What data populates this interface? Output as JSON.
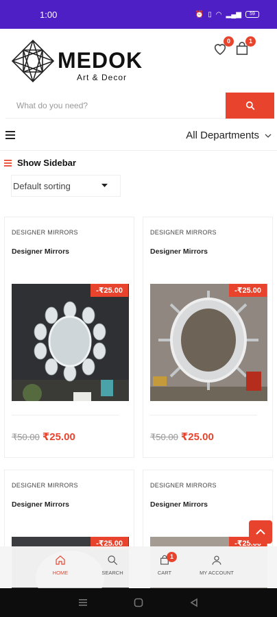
{
  "status": {
    "time": "1:00",
    "icons": [
      "alarm-icon",
      "vibrate-icon",
      "wifi-icon",
      "signal-icon",
      "battery-icon"
    ],
    "battery": "59"
  },
  "brand": {
    "name": "MEDOK",
    "tagline": "Art & Decor"
  },
  "header": {
    "wishlist_count": "0",
    "cart_count": "1"
  },
  "search": {
    "placeholder": "What do you need?"
  },
  "departments": {
    "label": "All Departments"
  },
  "sidebar": {
    "label": "Show Sidebar"
  },
  "sorting": {
    "selected": "Default sorting"
  },
  "products": [
    {
      "category": "DESIGNER MIRRORS",
      "title": "Designer Mirrors",
      "discount": "-₹25.00",
      "old_price": "₹50.00",
      "price": "₹25.00"
    },
    {
      "category": "DESIGNER MIRRORS",
      "title": "Designer Mirrors",
      "discount": "-₹25.00",
      "old_price": "₹50.00",
      "price": "₹25.00"
    },
    {
      "category": "DESIGNER MIRRORS",
      "title": "Designer Mirrors",
      "discount": "-₹25.00"
    },
    {
      "category": "DESIGNER MIRRORS",
      "title": "Designer Mirrors",
      "discount": "-₹25.00"
    }
  ],
  "tabbar": {
    "items": [
      {
        "label": "HOME",
        "icon": "home-icon"
      },
      {
        "label": "SEARCH",
        "icon": "search-icon"
      },
      {
        "label": "CART",
        "icon": "cart-icon",
        "badge": "1"
      },
      {
        "label": "MY ACCOUNT",
        "icon": "account-icon"
      }
    ]
  },
  "colors": {
    "accent": "#e8442d",
    "statusbar": "#4f1fc6"
  }
}
